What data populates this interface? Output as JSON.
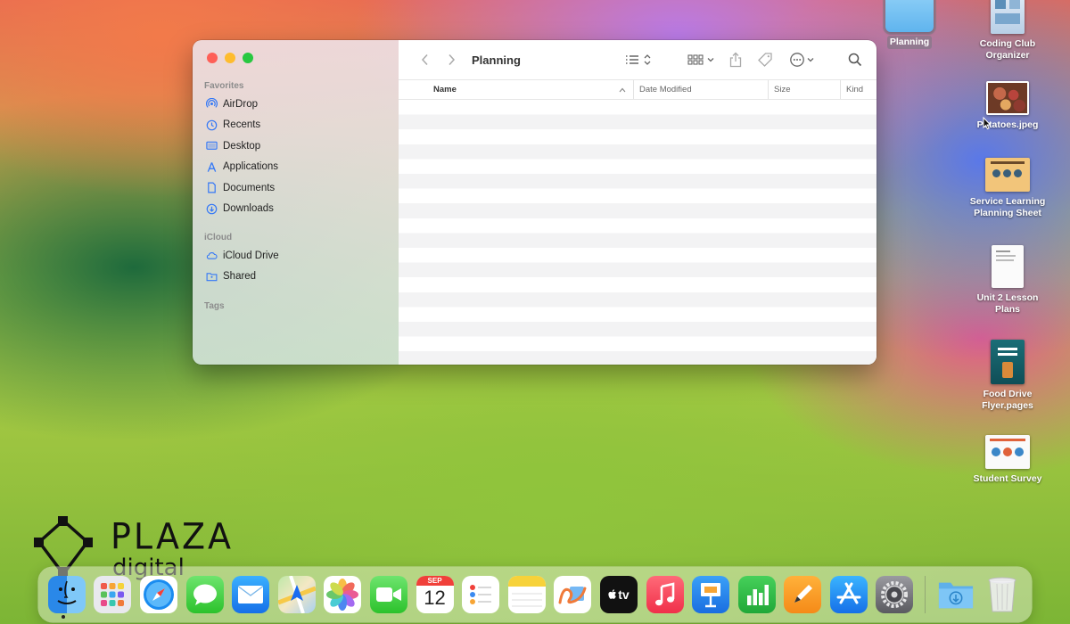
{
  "window": {
    "title": "Planning",
    "sidebar": {
      "favorites_label": "Favorites",
      "favorites": [
        {
          "label": "AirDrop",
          "icon": "airdrop-icon"
        },
        {
          "label": "Recents",
          "icon": "clock-icon"
        },
        {
          "label": "Desktop",
          "icon": "desktop-icon"
        },
        {
          "label": "Applications",
          "icon": "applications-icon"
        },
        {
          "label": "Documents",
          "icon": "document-icon"
        },
        {
          "label": "Downloads",
          "icon": "download-icon"
        }
      ],
      "icloud_label": "iCloud",
      "icloud": [
        {
          "label": "iCloud Drive",
          "icon": "cloud-icon"
        },
        {
          "label": "Shared",
          "icon": "shared-folder-icon"
        }
      ],
      "tags_label": "Tags"
    },
    "columns": {
      "name": "Name",
      "date_modified": "Date Modified",
      "size": "Size",
      "kind": "Kind"
    },
    "accent_color": "#3478f6"
  },
  "desktop": {
    "selected_folder": "Planning",
    "items": [
      {
        "label": "Coding Club Organizer"
      },
      {
        "label": "Potatoes.jpeg"
      },
      {
        "label": "Service Learning Planning Sheet"
      },
      {
        "label": "Unit 2 Lesson Plans"
      },
      {
        "label": "Food Drive Flyer.pages"
      },
      {
        "label": "Student Survey"
      }
    ]
  },
  "dock": {
    "calendar_month": "SEP",
    "calendar_day": "12",
    "tv_label": "tv",
    "apps": [
      "Finder",
      "Launchpad",
      "Safari",
      "Messages",
      "Mail",
      "Maps",
      "Photos",
      "FaceTime",
      "Calendar",
      "Reminders",
      "Notes",
      "Freeform",
      "TV",
      "Music",
      "Keynote",
      "Numbers",
      "Pages",
      "App Store",
      "System Settings",
      "Downloads",
      "Trash"
    ]
  },
  "watermark": {
    "line1": "PLAZA",
    "line2": "digital"
  }
}
